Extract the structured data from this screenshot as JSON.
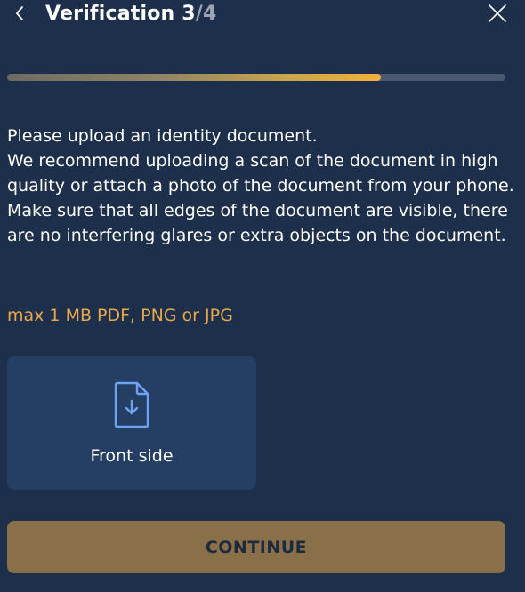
{
  "header": {
    "title_text": "Verification ",
    "step_current": "3",
    "step_separator": "/",
    "step_total": "4",
    "back_icon": "chevron-left-icon",
    "close_icon": "close-icon"
  },
  "progress": {
    "fraction": 0.75
  },
  "instructions": {
    "lines": [
      "Please upload an identity document.",
      "We recommend uploading a scan of the document in high quality or attach a photo of the document from your phone.",
      "Make sure that all edges of the document are visible, there are no interfering glares or extra objects on the document."
    ],
    "file_hint": "max 1 MB PDF, PNG or JPG"
  },
  "upload": {
    "label": "Front side",
    "icon": "file-download-icon"
  },
  "actions": {
    "continue_label": "CONTINUE"
  },
  "colors": {
    "background": "#1e2f4b",
    "card": "#253e63",
    "accent": "#e9a84a",
    "icon_blue": "#6ea2f5",
    "button": "#8a7048"
  }
}
